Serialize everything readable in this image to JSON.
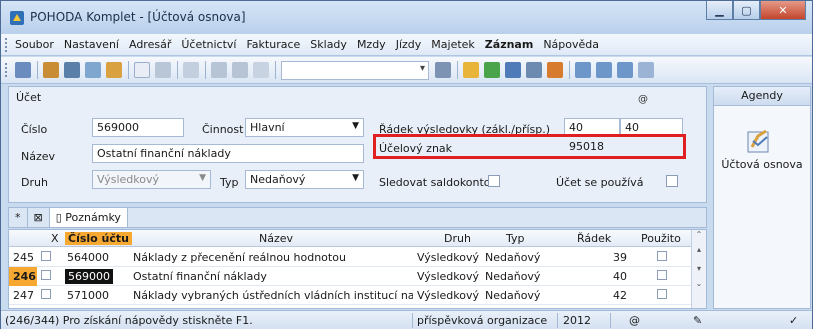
{
  "window": {
    "title": "POHODA Komplet - [Účtová osnova]"
  },
  "menu": {
    "items": [
      "Soubor",
      "Nastavení",
      "Adresář",
      "Účetnictví",
      "Fakturace",
      "Sklady",
      "Mzdy",
      "Jízdy",
      "Majetek",
      "Záznam",
      "Nápověda"
    ]
  },
  "form": {
    "section_label": "Účet",
    "cislo_label": "Číslo",
    "cislo_value": "569000",
    "cinnost_label": "Činnost",
    "cinnost_value": "Hlavní",
    "nazev_label": "Název",
    "nazev_value": "Ostatní finanční náklady",
    "druh_label": "Druh",
    "druh_value": "Výsledkový",
    "typ_label": "Typ",
    "typ_value": "Nedaňový",
    "radek_label": "Řádek výsledovky (zákl./přísp.)",
    "radek_zakl": "40",
    "radek_prisp": "40",
    "ucelovy_label": "Účelový znak",
    "ucelovy_value": "95018",
    "saldokonto_label": "Sledovat saldokonto",
    "pouziva_label": "Účet se používá"
  },
  "agendy": {
    "title": "Agendy",
    "item_label": "Účtová osnova"
  },
  "tabs": {
    "star": "*",
    "notes_label": "Poznámky"
  },
  "table": {
    "headers": {
      "x": "X",
      "cislo": "Číslo účtu",
      "nazev": "Název",
      "druh": "Druh",
      "typ": "Typ",
      "radek": "Řádek",
      "pouzito": "Použito"
    },
    "rows": [
      {
        "num": "245",
        "cislo": "564000",
        "nazev": "Náklady z přecenění reálnou hodnotou",
        "druh": "Výsledkový",
        "typ": "Nedaňový",
        "radek": "39"
      },
      {
        "num": "246",
        "cislo": "569000",
        "nazev": "Ostatní finanční náklady",
        "druh": "Výsledkový",
        "typ": "Nedaňový",
        "radek": "40"
      },
      {
        "num": "247",
        "cislo": "571000",
        "nazev": "Náklady vybraných ústředních vládních institucí na tran",
        "druh": "Výsledkový",
        "typ": "Nedaňový",
        "radek": "42"
      }
    ]
  },
  "status": {
    "left": "(246/344) Pro získání nápovědy stiskněte F1.",
    "org": "příspěvková organizace",
    "year": "2012",
    "at": "@"
  },
  "colors": {
    "highlight": "#e02020",
    "current_row": "#f7a831"
  }
}
